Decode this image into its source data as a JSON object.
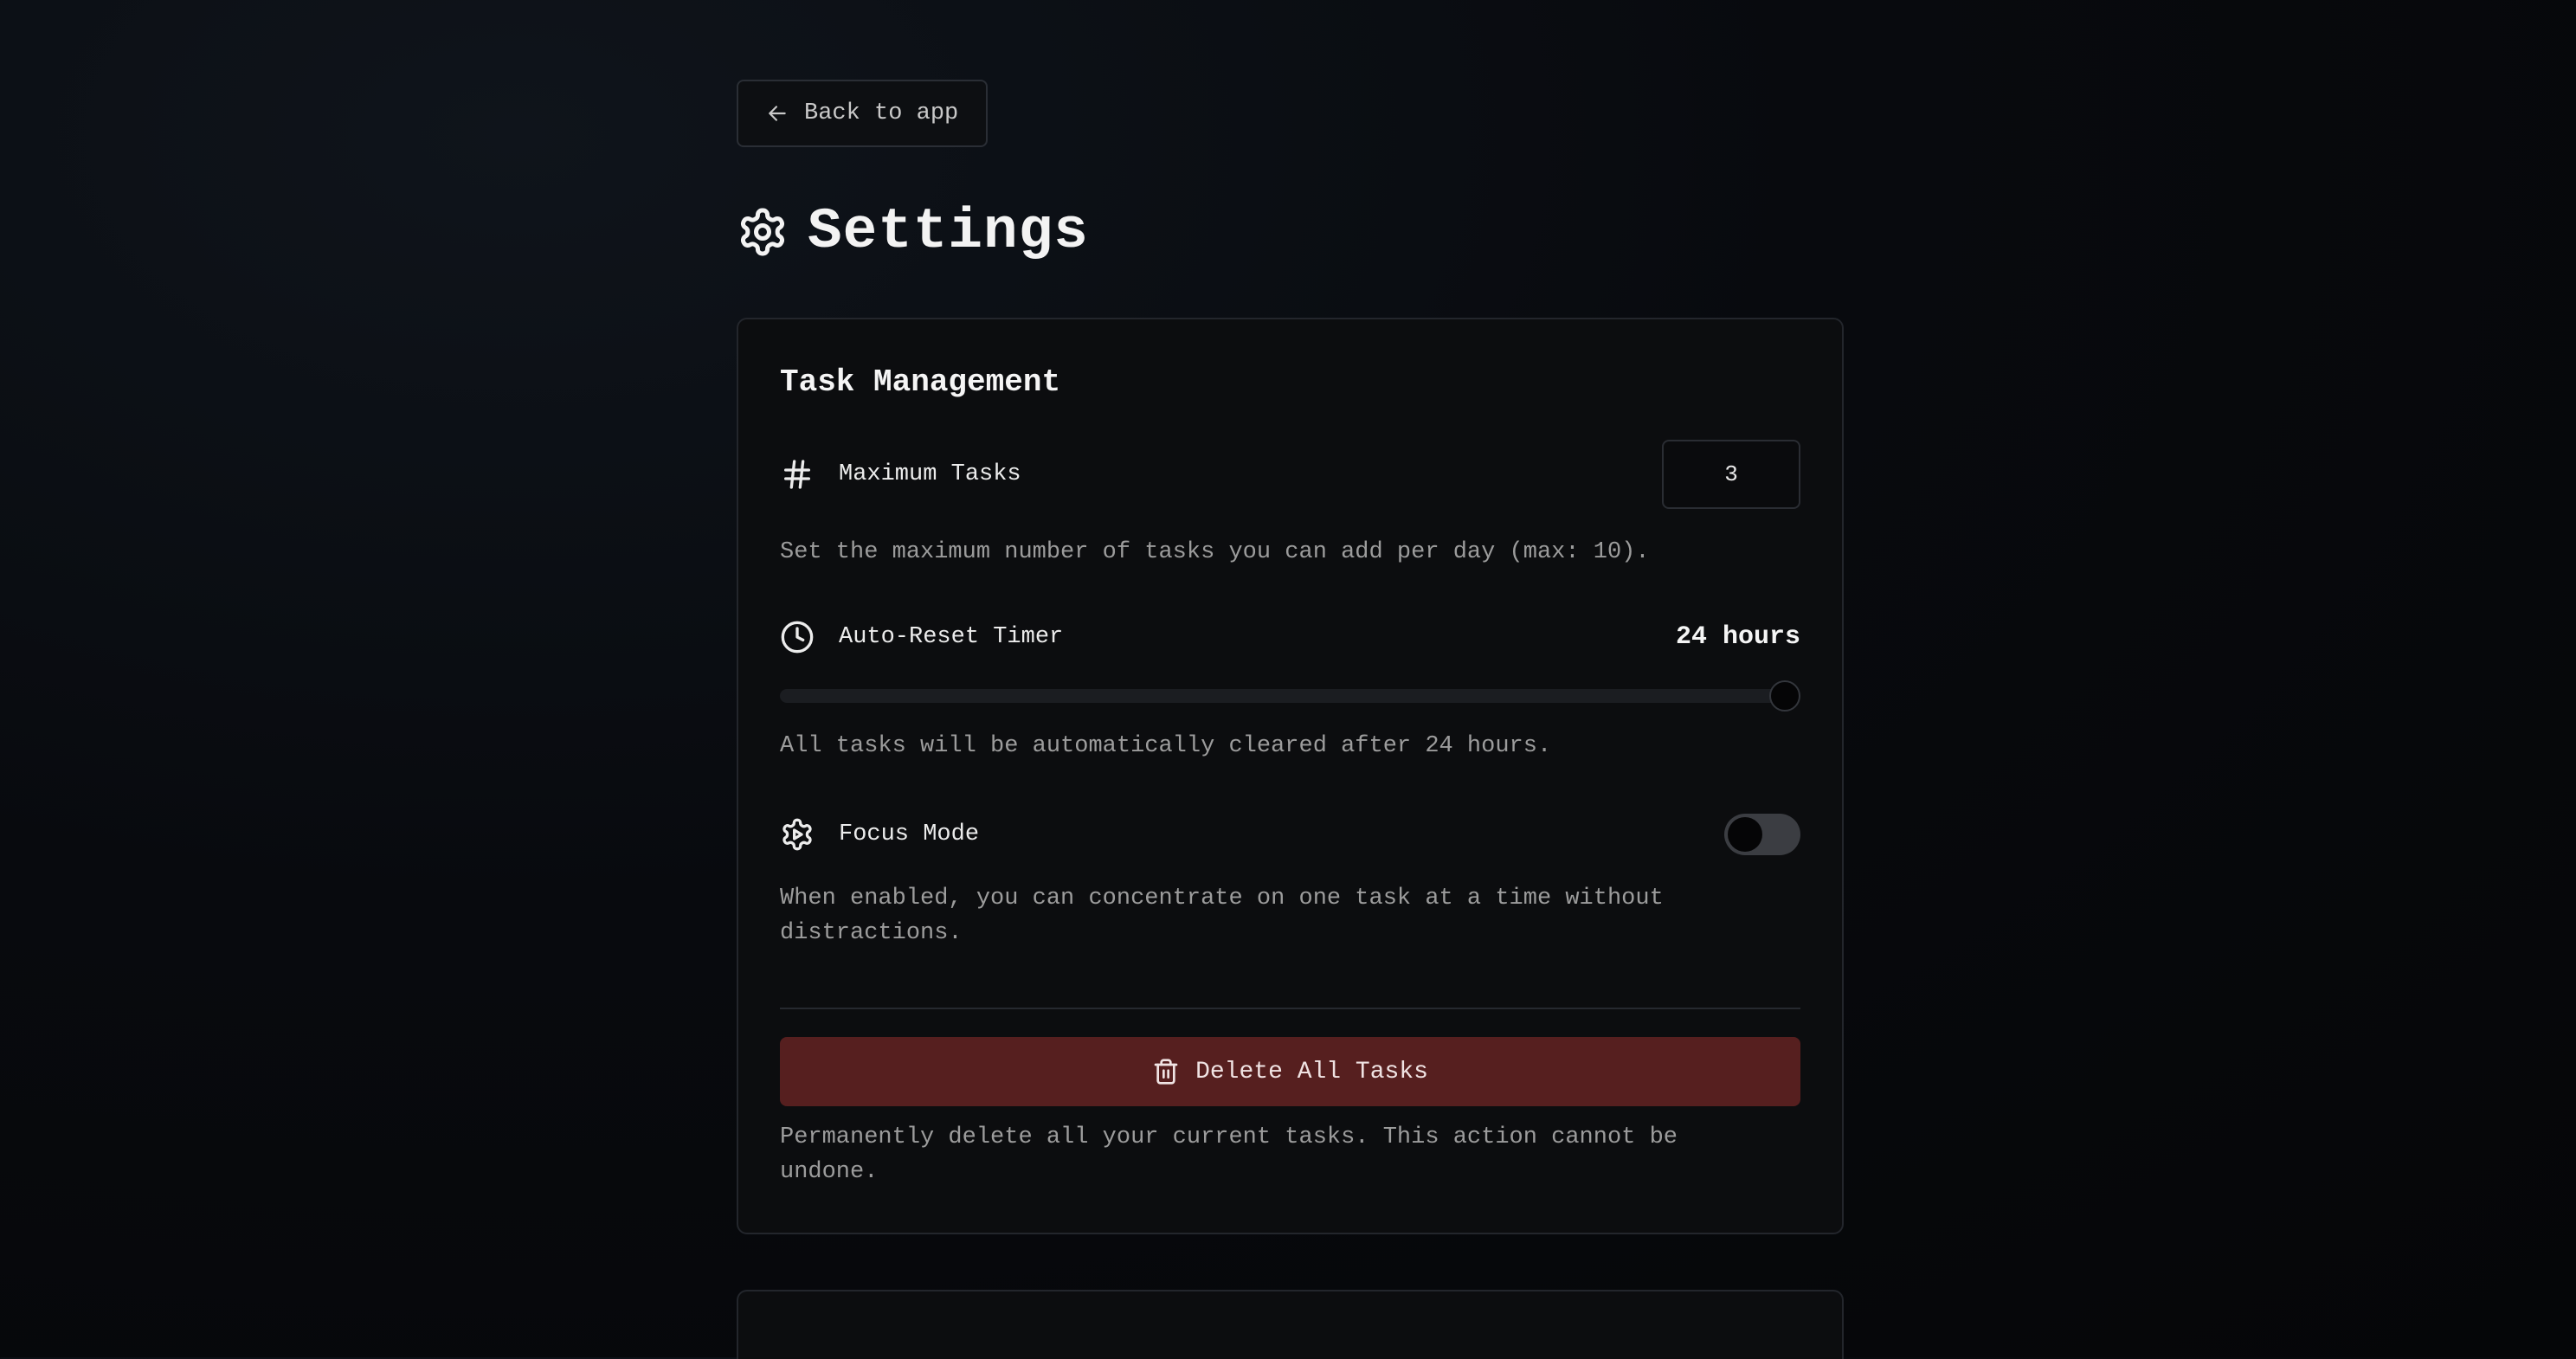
{
  "back": {
    "label": "Back to app",
    "icon": "arrow-left-icon"
  },
  "page": {
    "title": "Settings",
    "icon": "gear-icon"
  },
  "task_management": {
    "title": "Task Management",
    "max_tasks": {
      "label": "Maximum Tasks",
      "icon": "hash-icon",
      "value": "3",
      "description": "Set the maximum number of tasks you can add per day (max: 10)."
    },
    "auto_reset": {
      "label": "Auto-Reset Timer",
      "icon": "clock-icon",
      "value_display": "24 hours",
      "value_hours": 24,
      "max_hours": 24,
      "description": "All tasks will be automatically cleared after 24 hours."
    },
    "focus_mode": {
      "label": "Focus Mode",
      "icon": "focus-gear-icon",
      "enabled": false,
      "description": "When enabled, you can concentrate on one task at a time without distractions."
    },
    "delete_all": {
      "label": "Delete All Tasks",
      "icon": "trash-icon",
      "color": "#561f1f",
      "description": "Permanently delete all your current tasks. This action cannot be undone."
    }
  }
}
